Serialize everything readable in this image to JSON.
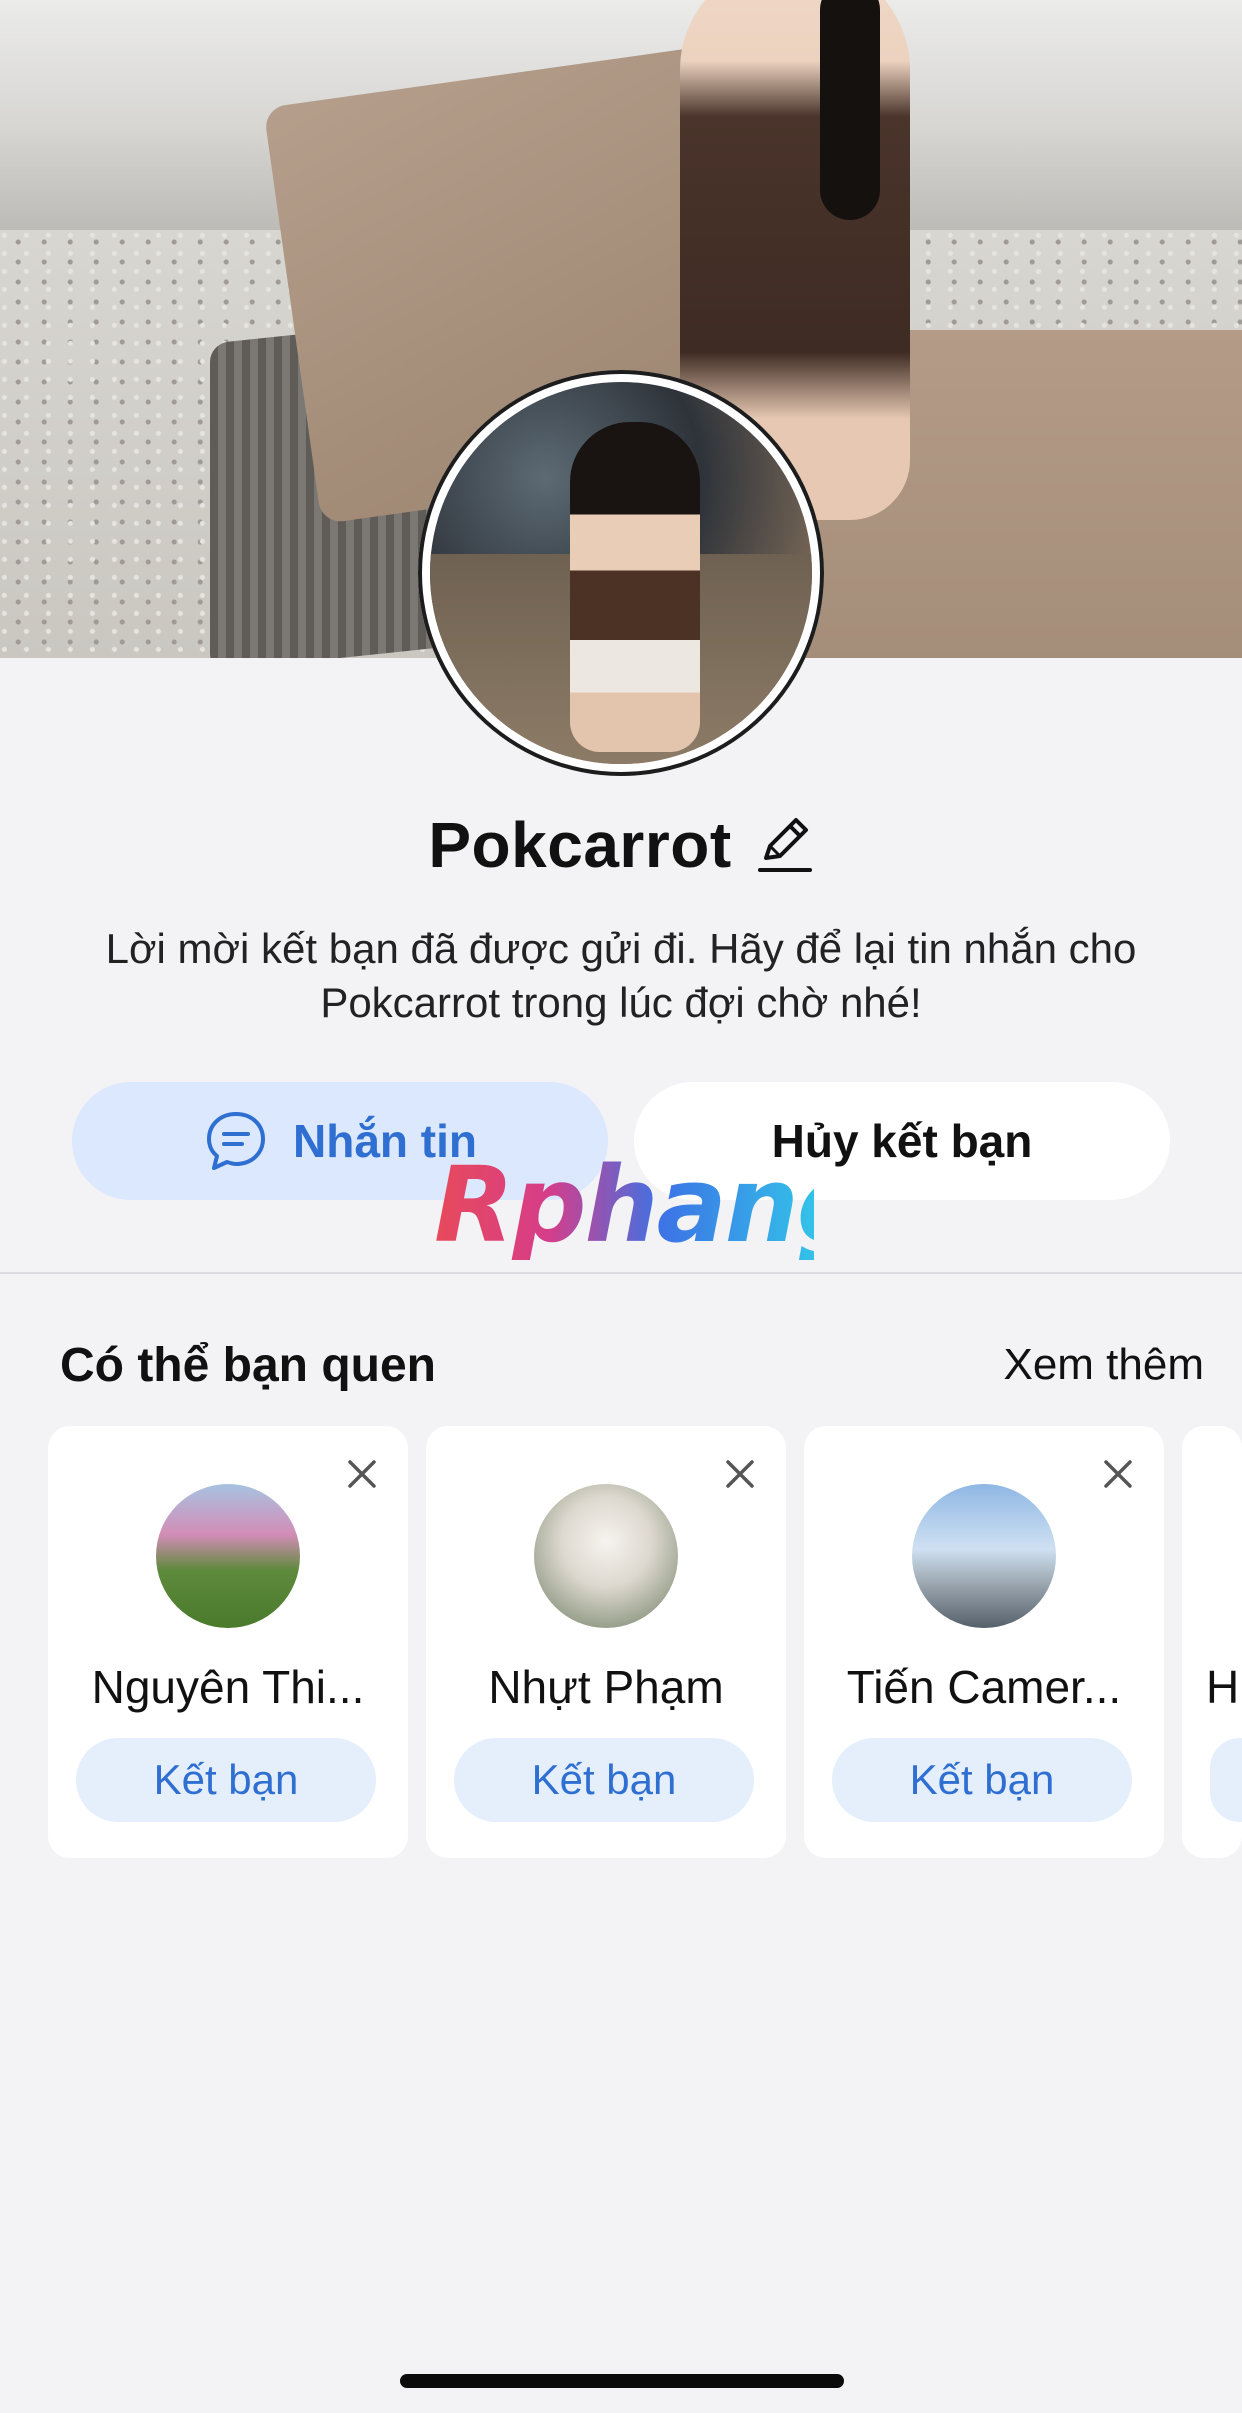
{
  "profile": {
    "name": "Pokcarrot",
    "notice": "Lời mời kết bạn đã được gửi đi. Hãy để lại tin nhắn cho Pokcarrot trong lúc đợi chờ nhé!"
  },
  "actions": {
    "message_label": "Nhắn tin",
    "unfriend_label": "Hủy kết bạn"
  },
  "watermark": "Rphang",
  "suggestions": {
    "title": "Có thể bạn quen",
    "see_more": "Xem thêm",
    "cards": [
      {
        "name": "Nguyên Thi...",
        "add_label": "Kết bạn"
      },
      {
        "name": "Nhựt Phạm",
        "add_label": "Kết bạn"
      },
      {
        "name": "Tiến Camer...",
        "add_label": "Kết bạn"
      },
      {
        "name": "H",
        "add_label": ""
      }
    ]
  },
  "icons": {
    "edit": "pencil-icon",
    "message": "chat-bubble-icon",
    "dismiss": "close-icon"
  },
  "colors": {
    "accent": "#2f6fd1",
    "accent_bg": "#dbe8fd",
    "page_bg": "#f3f3f6"
  }
}
